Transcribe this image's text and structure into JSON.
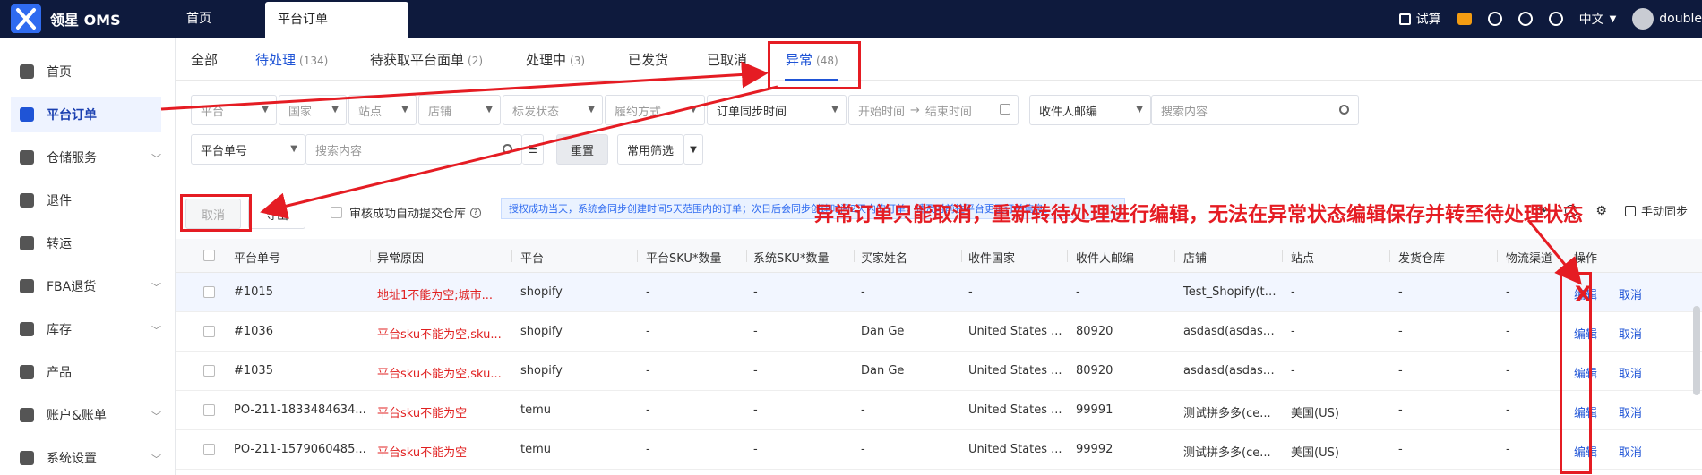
{
  "app": {
    "name": "领星 OMS"
  },
  "top_tabs": [
    {
      "label": "首页"
    },
    {
      "label": "平台订单"
    }
  ],
  "top_right": {
    "trial": "试算",
    "language": "中文",
    "user": "double"
  },
  "sidebar": {
    "items": [
      {
        "label": "首页"
      },
      {
        "label": "平台订单"
      },
      {
        "label": "仓储服务"
      },
      {
        "label": "退件"
      },
      {
        "label": "转运"
      },
      {
        "label": "FBA退货"
      },
      {
        "label": "库存"
      },
      {
        "label": "产品"
      },
      {
        "label": "账户&账单"
      },
      {
        "label": "系统设置"
      }
    ]
  },
  "status_tabs": [
    {
      "label": "全部",
      "count": ""
    },
    {
      "label": "待处理",
      "count": "(134)"
    },
    {
      "label": "待获取平台面单",
      "count": "(2)"
    },
    {
      "label": "处理中",
      "count": "(3)"
    },
    {
      "label": "已发货",
      "count": ""
    },
    {
      "label": "已取消",
      "count": ""
    },
    {
      "label": "异常",
      "count": "(48)"
    }
  ],
  "filters": {
    "platform": "平台",
    "country": "国家",
    "site": "站点",
    "shop": "店铺",
    "label_status": "标发状态",
    "fulfill": "履约方式",
    "sync_time": "订单同步时间",
    "start_time": "开始时间",
    "arrow": "→",
    "end_time": "结束时间",
    "zip_select": "收件人邮编",
    "search1_placeholder": "搜索内容",
    "order_no_select": "平台单号",
    "search2_placeholder": "搜索内容",
    "reset": "重置",
    "common_filter": "常用筛选"
  },
  "actions": {
    "cancel": "取消",
    "export": "导出",
    "auto_submit": "审核成功自动提交仓库",
    "notice": "授权成功当天，系统会同步创建时间5天范围内的订单；次日后会同步创建时间2天内的订单；请及时前往平台更正订单信息。",
    "manual_sync": "手动同步"
  },
  "annotation": "异常订单只能取消，重新转待处理进行编辑，无法在异常状态编辑保存并转至待处理状态",
  "table": {
    "headers": [
      "平台单号",
      "异常原因",
      "平台",
      "平台SKU*数量",
      "系统SKU*数量",
      "买家姓名",
      "收件国家",
      "收件人邮编",
      "店铺",
      "站点",
      "发货仓库",
      "物流渠道",
      "操作"
    ],
    "rows": [
      {
        "order": "#1015",
        "reason": "地址1不能为空;城市...",
        "platform": "shopify",
        "psku": "-",
        "ssku": "-",
        "buyer": "-",
        "country": "-",
        "zip": "-",
        "shop": "Test_Shopify(te...",
        "site": "-",
        "warehouse": "-",
        "channel": "-",
        "edit": "编辑",
        "cancel": "取消"
      },
      {
        "order": "#1036",
        "reason": "平台sku不能为空,sku...",
        "platform": "shopify",
        "psku": "-",
        "ssku": "-",
        "buyer": "Dan Ge",
        "country": "United States ...",
        "zip": "80920",
        "shop": "asdasd(asdasd...",
        "site": "-",
        "warehouse": "-",
        "channel": "-",
        "edit": "编辑",
        "cancel": "取消"
      },
      {
        "order": "#1035",
        "reason": "平台sku不能为空,sku...",
        "platform": "shopify",
        "psku": "-",
        "ssku": "-",
        "buyer": "Dan Ge",
        "country": "United States ...",
        "zip": "80920",
        "shop": "asdasd(asdasd...",
        "site": "-",
        "warehouse": "-",
        "channel": "-",
        "edit": "编辑",
        "cancel": "取消"
      },
      {
        "order": "PO-211-1833484634...",
        "reason": "平台sku不能为空",
        "platform": "temu",
        "psku": "-",
        "ssku": "-",
        "buyer": "-",
        "country": "United States ...",
        "zip": "99991",
        "shop": "测试拼多多(ce...",
        "site": "美国(US)",
        "warehouse": "-",
        "channel": "-",
        "edit": "编辑",
        "cancel": "取消"
      },
      {
        "order": "PO-211-1579060485...",
        "reason": "平台sku不能为空",
        "platform": "temu",
        "psku": "-",
        "ssku": "-",
        "buyer": "-",
        "country": "United States ...",
        "zip": "99992",
        "shop": "测试拼多多(ce...",
        "site": "美国(US)",
        "warehouse": "-",
        "channel": "-",
        "edit": "编辑",
        "cancel": "取消"
      }
    ]
  },
  "colors": {
    "topbar": "#0e1a3d",
    "accent": "#1f54d6",
    "error": "#e02020",
    "annotation": "#e51c23"
  }
}
